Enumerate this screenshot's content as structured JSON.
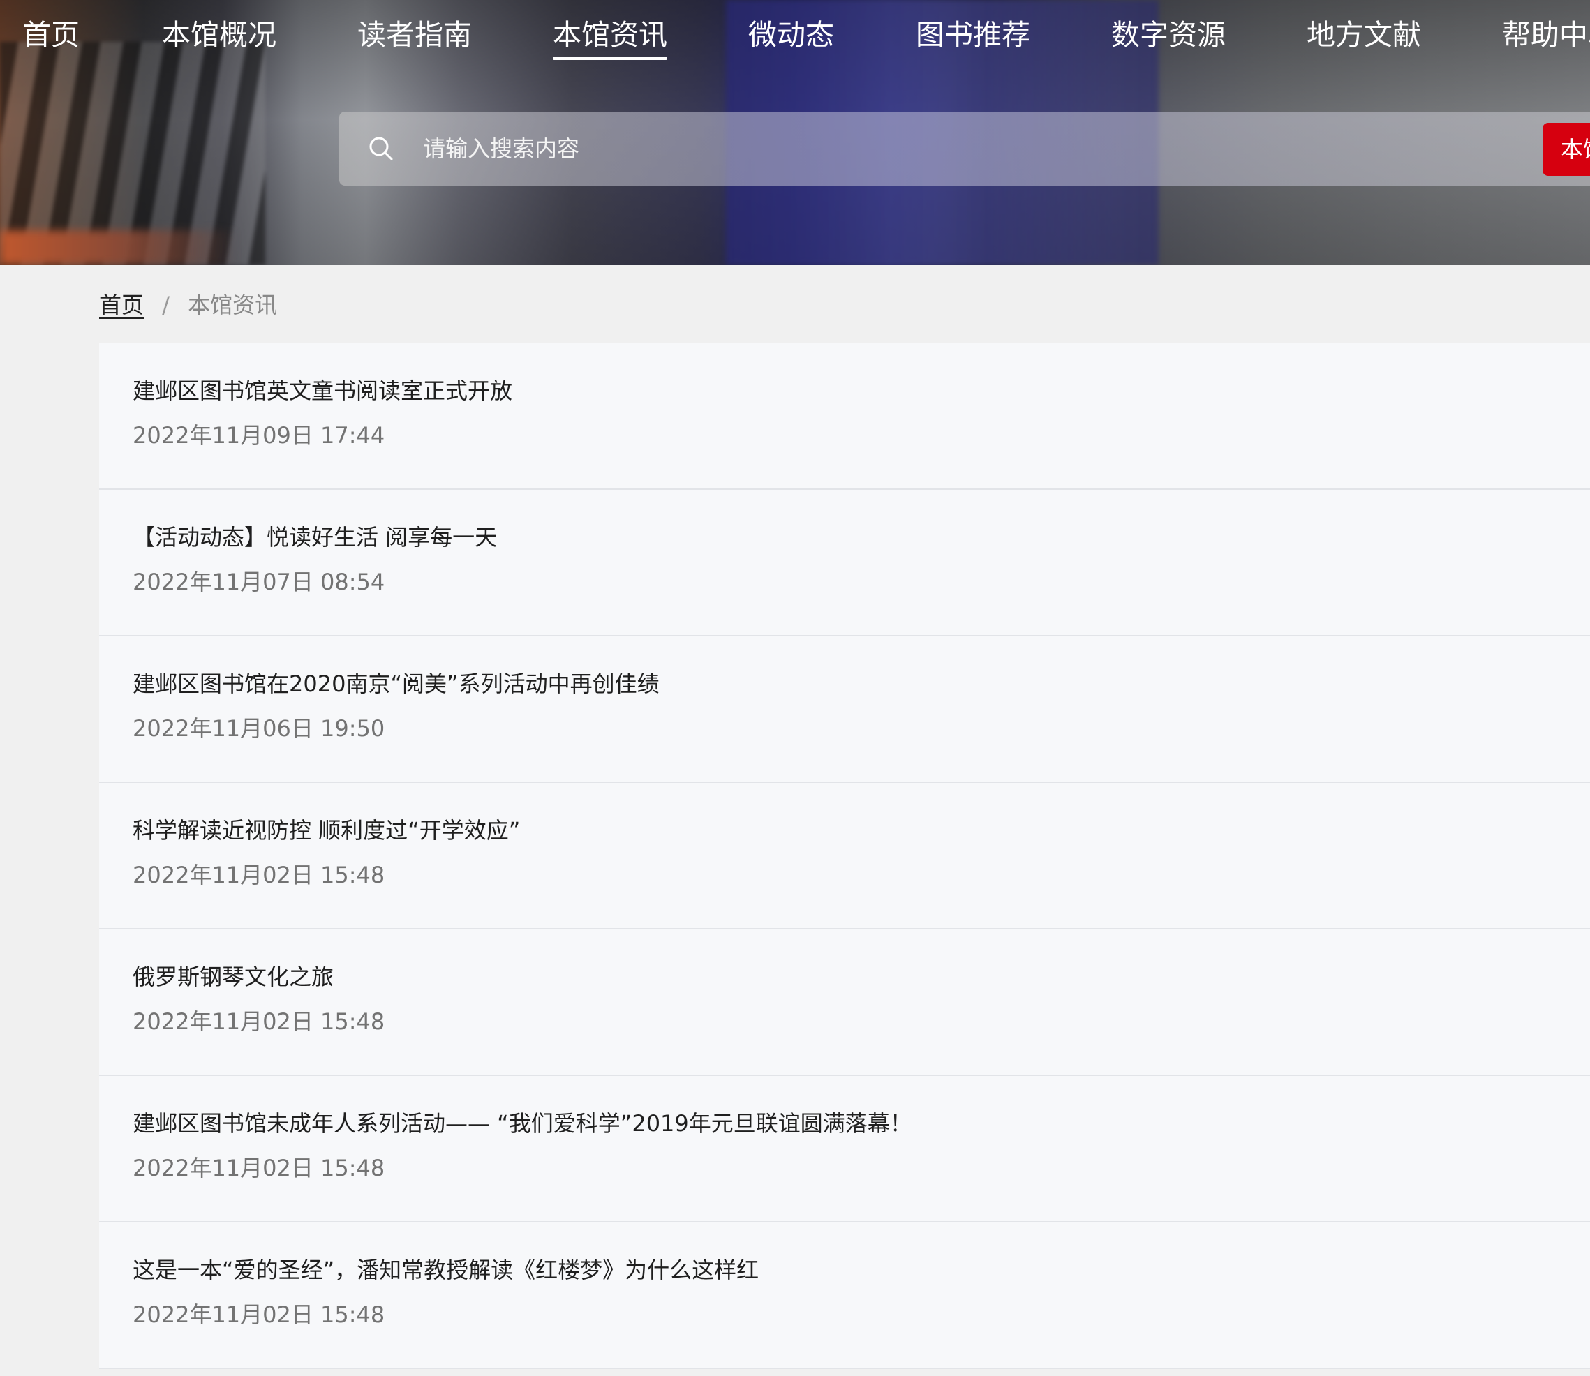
{
  "nav": {
    "items": [
      {
        "label": "首页"
      },
      {
        "label": "本馆概况"
      },
      {
        "label": "读者指南"
      },
      {
        "label": "本馆资讯",
        "active": true
      },
      {
        "label": "微动态"
      },
      {
        "label": "图书推荐"
      },
      {
        "label": "数字资源"
      },
      {
        "label": "地方文献"
      },
      {
        "label": "帮助中心"
      }
    ]
  },
  "search": {
    "placeholder": "请输入搜索内容",
    "scope_button": "本馆",
    "icon": "search-icon"
  },
  "breadcrumb": {
    "home": "首页",
    "separator": "/",
    "current": "本馆资讯"
  },
  "news": [
    {
      "title": "建邺区图书馆英文童书阅读室正式开放",
      "date": "2022年11月09日 17:44"
    },
    {
      "title": "【活动动态】悦读好生活 阅享每一天",
      "date": "2022年11月07日 08:54"
    },
    {
      "title": "建邺区图书馆在2020南京“阅美”系列活动中再创佳绩",
      "date": "2022年11月06日 19:50"
    },
    {
      "title": "科学解读近视防控 顺利度过“开学效应”",
      "date": "2022年11月02日 15:48"
    },
    {
      "title": "俄罗斯钢琴文化之旅",
      "date": "2022年11月02日 15:48"
    },
    {
      "title": "建邺区图书馆未成年人系列活动—— “我们爱科学”2019年元旦联谊圆满落幕！",
      "date": "2022年11月02日 15:48"
    },
    {
      "title": "这是一本“爱的圣经”，潘知常教授解读《红楼梦》为什么这样红",
      "date": "2022年11月02日 15:48"
    }
  ],
  "colors": {
    "accent_red": "#d6000f",
    "list_bg": "#f7f8fa",
    "page_bg": "#f0f0f0"
  }
}
